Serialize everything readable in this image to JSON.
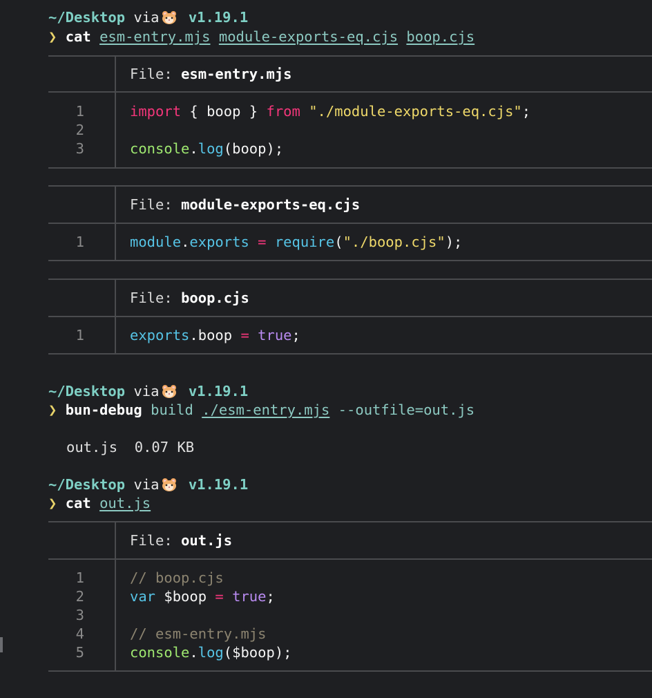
{
  "prompt": {
    "dir": "~/Desktop",
    "via": "via",
    "version": "v1.19.1",
    "chevron": "❯"
  },
  "commands": {
    "cmd1": {
      "name": "cat",
      "args": [
        "esm-entry.mjs",
        "module-exports-eq.cjs",
        "boop.cjs"
      ]
    },
    "cmd2": {
      "name": "bun-debug",
      "sub": "build",
      "arg": "./esm-entry.mjs",
      "flag": "--outfile=out.js"
    },
    "cmd3": {
      "name": "cat",
      "arg": "out.js"
    }
  },
  "build_output": "out.js  0.07 KB",
  "files": {
    "f1": {
      "label": "File:",
      "name": "esm-entry.mjs",
      "lines": [
        "1",
        "2",
        "3"
      ]
    },
    "f2": {
      "label": "File:",
      "name": "module-exports-eq.cjs",
      "lines": [
        "1"
      ]
    },
    "f3": {
      "label": "File:",
      "name": "boop.cjs",
      "lines": [
        "1"
      ]
    },
    "f4": {
      "label": "File:",
      "name": "out.js",
      "lines": [
        "1",
        "2",
        "3",
        "4",
        "5"
      ]
    }
  },
  "code": {
    "f1": {
      "l1": {
        "import": "import",
        "brace_open": " { ",
        "id": "boop",
        "brace_close": " } ",
        "from": "from",
        "sp": " ",
        "path": "\"./module-exports-eq.cjs\"",
        "end": ";"
      },
      "l3": {
        "obj": "console",
        "dot": ".",
        "method": "log",
        "args": "(boop);"
      }
    },
    "f2": {
      "l1": {
        "obj": "module",
        "dot": ".",
        "prop": "exports",
        "eq": " = ",
        "fn": "require",
        "open": "(",
        "path": "\"./boop.cjs\"",
        "close": ");"
      }
    },
    "f3": {
      "l1": {
        "obj": "exports",
        "rest": ".boop",
        "eq": " = ",
        "val": "true",
        "end": ";"
      }
    },
    "f4": {
      "l1": "// boop.cjs",
      "l2": {
        "kw": "var",
        "id": " $boop",
        "eq": " = ",
        "val": "true",
        "end": ";"
      },
      "l4": "// esm-entry.mjs",
      "l5": {
        "obj": "console",
        "dot": ".",
        "method": "log",
        "args": "($boop);"
      }
    }
  },
  "colors": {
    "background": "#1e1f22",
    "accent": "#7fd0c5",
    "keyword": "#f3367a",
    "string": "#efd96a",
    "function": "#9fe870",
    "boolean": "#b98bf1",
    "comment": "#8c8470"
  }
}
